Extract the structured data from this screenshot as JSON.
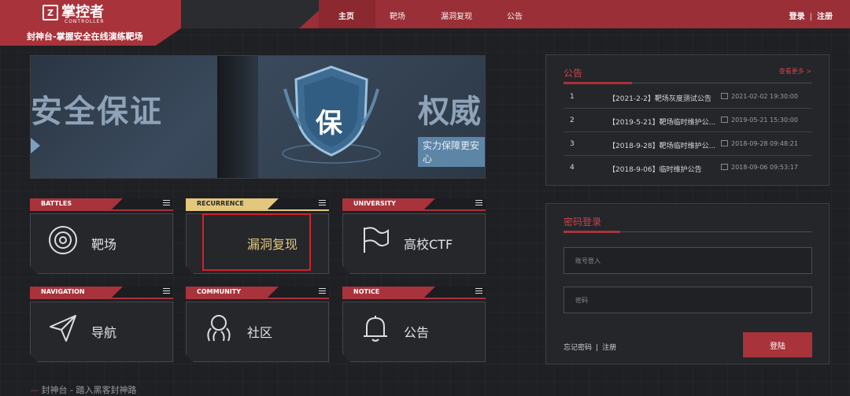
{
  "header": {
    "logo_mark": "Z",
    "logo_text": "掌控者",
    "logo_sub": "CONTROLLER",
    "tagline": "封神台-掌握安全在线演练靶场",
    "nav": [
      "主页",
      "靶场",
      "漏洞复现",
      "公告"
    ],
    "login": "登录",
    "register": "注册"
  },
  "banner": {
    "left_title": "安全保证",
    "shield_char": "保",
    "right_title": "权威",
    "right_sub": "实力保障更安心"
  },
  "cards": [
    {
      "category": "BATTLES",
      "label": "靶场",
      "icon": "target-icon"
    },
    {
      "category": "RECURRENCE",
      "label": "漏洞复现",
      "icon": "bug-search-icon"
    },
    {
      "category": "UNIVERSITY",
      "label": "高校CTF",
      "icon": "flag-icon"
    },
    {
      "category": "NAVIGATION",
      "label": "导航",
      "icon": "send-icon"
    },
    {
      "category": "COMMUNITY",
      "label": "社区",
      "icon": "community-icon"
    },
    {
      "category": "NOTICE",
      "label": "公告",
      "icon": "bell-icon"
    }
  ],
  "footer_tag": "封神台 - 踏入黑客封神路",
  "notice": {
    "title": "公告",
    "more": "查看更多 >",
    "items": [
      {
        "idx": "1",
        "title": "【2021-2-2】靶场灰度测试公告",
        "date": "2021-02-02 19:30:00"
      },
      {
        "idx": "2",
        "title": "【2019-5-21】靶场临时维护公...",
        "date": "2019-05-21 15:30:00"
      },
      {
        "idx": "3",
        "title": "【2018-9-28】靶场临时维护公...",
        "date": "2018-09-28 09:48:21"
      },
      {
        "idx": "4",
        "title": "【2018-9-06】临时维护公告",
        "date": "2018-09-06 09:53:17"
      }
    ]
  },
  "login": {
    "title": "密码登录",
    "account_placeholder": "账号登入",
    "password_placeholder": "密码",
    "forgot": "忘记密码",
    "register": "注册",
    "submit": "登陆"
  },
  "colors": {
    "accent": "#a8333b",
    "gold": "#e3c77c",
    "background": "#1e2024"
  }
}
